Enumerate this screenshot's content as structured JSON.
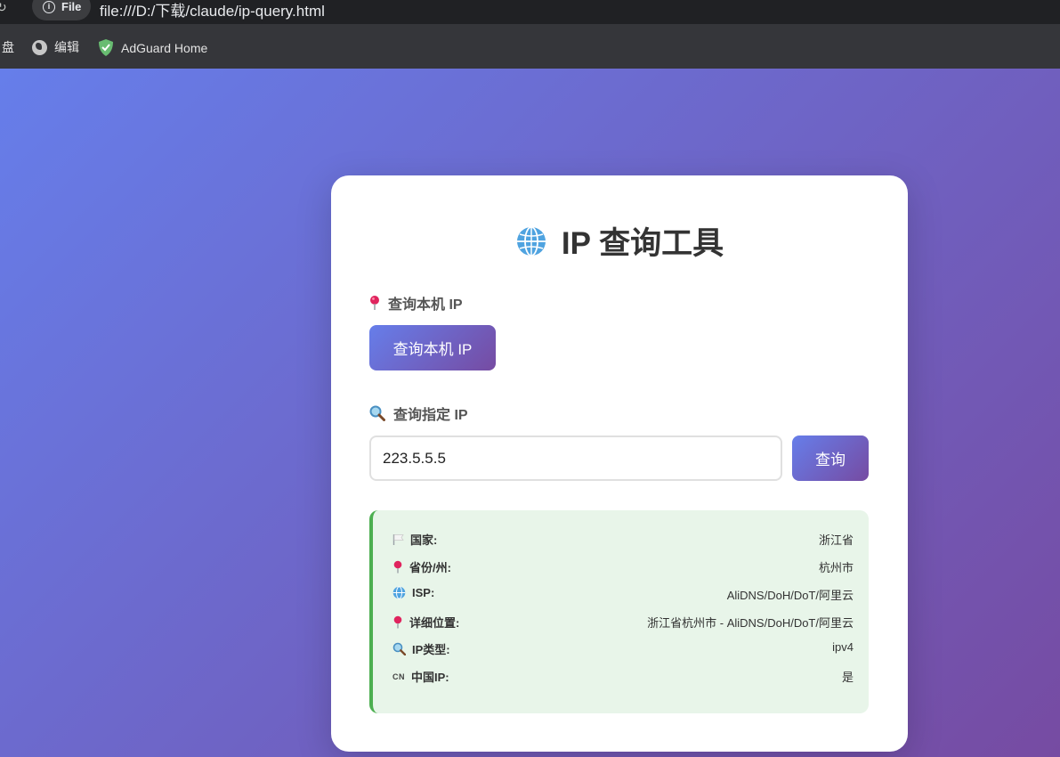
{
  "browser": {
    "chip_label": "File",
    "url": "file:///D:/下载/claude/ip-query.html",
    "bookmarks": [
      {
        "label": "盘",
        "icon": "none"
      },
      {
        "label": "编辑",
        "icon": "globe-icon"
      },
      {
        "label": "AdGuard Home",
        "icon": "shield-icon"
      }
    ],
    "icons": [
      "reload-icon",
      "info-icon"
    ]
  },
  "card": {
    "title": "IP 查询工具",
    "title_icon": "globe-icon",
    "local_section": {
      "label": "查询本机 IP",
      "icon": "pin-icon",
      "button": "查询本机 IP"
    },
    "query_section": {
      "label": "查询指定 IP",
      "icon": "magnifier-icon",
      "input_value": "223.5.5.5",
      "button": "查询"
    },
    "result": {
      "rows": [
        {
          "icon": "flag-icon",
          "key": "国家:",
          "value": "浙江省"
        },
        {
          "icon": "pin-icon",
          "key": "省份/州:",
          "value": "杭州市"
        },
        {
          "icon": "globe-icon",
          "key": "ISP:",
          "value": "AliDNS/DoH/DoT/阿里云"
        },
        {
          "icon": "pin-icon",
          "key": "详细位置:",
          "value": "浙江省杭州市 - AliDNS/DoH/DoT/阿里云"
        },
        {
          "icon": "magnifier-icon",
          "key": "IP类型:",
          "value": "ipv4"
        },
        {
          "icon": "cn-icon",
          "icon_text": "CN",
          "key": "中国IP:",
          "value": "是"
        }
      ]
    }
  },
  "colors": {
    "background_gradient": [
      "#667eea",
      "#764ba2"
    ],
    "result_bg": "#e8f5e9",
    "result_border": "#4caf50",
    "text": "#333333"
  }
}
